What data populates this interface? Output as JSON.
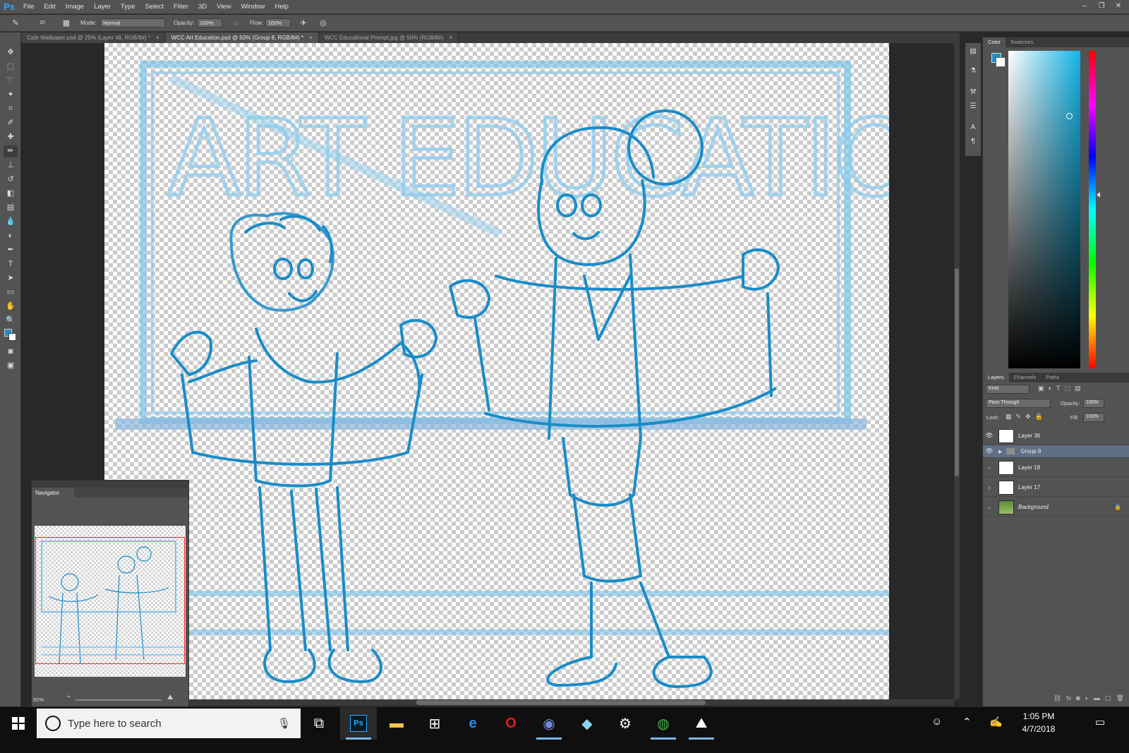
{
  "menubar": {
    "logo": "Ps",
    "items": [
      "File",
      "Edit",
      "Image",
      "Layer",
      "Type",
      "Select",
      "Filter",
      "3D",
      "View",
      "Window",
      "Help"
    ],
    "window_controls": [
      "–",
      "❐",
      "✕"
    ]
  },
  "options": {
    "brush_size": "20",
    "mode_label": "Mode:",
    "mode_value": "Normal",
    "opacity_label": "Opacity:",
    "opacity_value": "100%",
    "flow_label": "Flow:",
    "flow_value": "100%"
  },
  "tabs": [
    {
      "label": "Cafe Wallpaper.psd @ 25% (Layer 46, RGB/8#) *",
      "close": "×"
    },
    {
      "label": "WCC Art Education.psd @ 50% (Group 8, RGB/8#) *",
      "close": "×"
    },
    {
      "label": "WCC Educational Prompt.jpg @ 50% (RGB/8#)",
      "close": "×"
    }
  ],
  "tools": [
    "move-icon",
    "marquee-icon",
    "lasso-icon",
    "magic-wand-icon",
    "crop-icon",
    "eyedropper-icon",
    "healing-icon",
    "brush-icon",
    "stamp-icon",
    "history-brush-icon",
    "eraser-icon",
    "gradient-icon",
    "blur-icon",
    "dodge-icon",
    "pen-icon",
    "type-icon",
    "path-select-icon",
    "shape-icon",
    "hand-icon",
    "zoom-icon"
  ],
  "canvas_text": "ART EDUCATION",
  "navigator": {
    "title": "Navigator",
    "zoom": "50%"
  },
  "color_panel": {
    "tabs": [
      "Color",
      "Swatches"
    ],
    "foreground": "#1f8ec9",
    "background": "#ffffff"
  },
  "layers_panel": {
    "tabs": [
      "Layers",
      "Channels",
      "Paths"
    ],
    "filter": "Kind",
    "blend_mode": "Pass Through",
    "opacity_label": "Opacity:",
    "opacity_value": "100%",
    "lock_label": "Lock:",
    "fill_label": "Fill:",
    "fill_value": "100%",
    "layers": [
      {
        "name": "Layer 36",
        "visible": true,
        "type": "layer"
      },
      {
        "name": "Group 8",
        "visible": true,
        "type": "group",
        "selected": true
      },
      {
        "name": "Layer 18",
        "visible": false,
        "type": "layer"
      },
      {
        "name": "Layer 17",
        "visible": false,
        "type": "layer"
      },
      {
        "name": "Background",
        "visible": false,
        "type": "background",
        "locked": true
      }
    ]
  },
  "taskbar": {
    "search_placeholder": "Type here to search",
    "time": "1:05 PM",
    "date": "4/7/2018"
  },
  "colors": {
    "sketch": "#1a8cc8",
    "sketch_light": "#7cc3ea",
    "accent": "#31a8ff"
  }
}
